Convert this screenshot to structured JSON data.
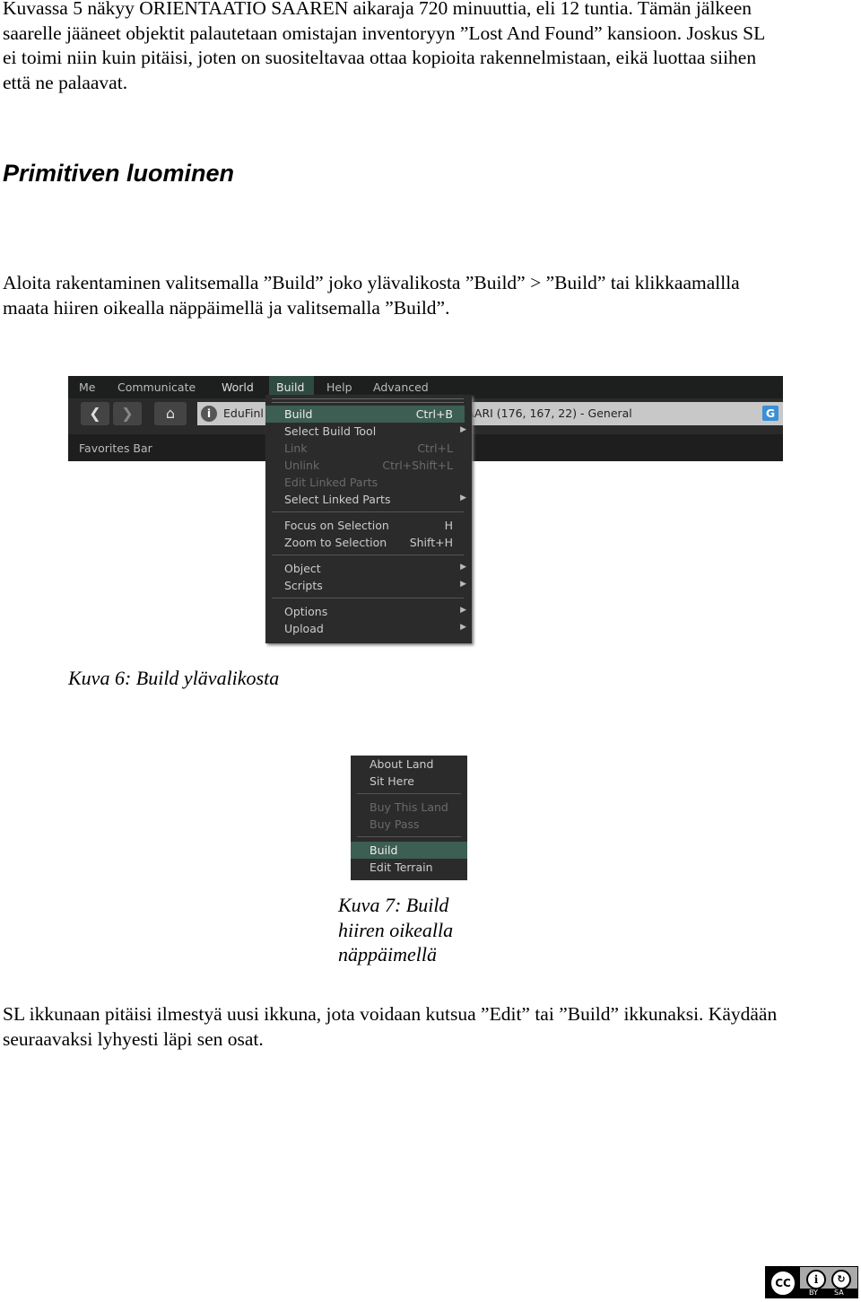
{
  "intro": {
    "lines": [
      "Kuvassa 5 näkyy ORIENTAATIO SAAREN aikaraja 720 minuuttia, eli 12 tuntia. Tämän jälkeen",
      "saarelle jääneet objektit palautetaan omistajan inventoryyn ”Lost And Found” kansioon. Joskus SL",
      "ei toimi niin kuin pitäisi, joten on suositeltavaa ottaa kopioita rakennelmistaan, eikä luottaa siihen",
      "että ne palaavat."
    ]
  },
  "heading": "Primitiven luominen",
  "para2": {
    "lines": [
      "Aloita rakentaminen valitsemalla ”Build” joko ylävalikosta ”Build” > ”Build”  tai klikkaamallla",
      "maata hiiren oikealla näppäimellä ja valitsemalla ”Build”."
    ]
  },
  "screenshot1": {
    "menubar": [
      "Me",
      "Communicate",
      "World",
      "Build",
      "Help",
      "Advanced"
    ],
    "location_left": "EduFinl",
    "location_right": "AARI (176, 167, 22) - General",
    "location_badge": "G",
    "favorites": "Favorites Bar",
    "menu": [
      {
        "label": "Build",
        "shortcut": "Ctrl+B",
        "state": "highlighted"
      },
      {
        "label": "Select Build Tool",
        "submenu": true
      },
      {
        "label": "Link",
        "shortcut": "Ctrl+L",
        "state": "disabled"
      },
      {
        "label": "Unlink",
        "shortcut": "Ctrl+Shift+L",
        "state": "disabled"
      },
      {
        "label": "Edit Linked Parts",
        "state": "disabled"
      },
      {
        "label": "Select Linked Parts",
        "submenu": true
      },
      {
        "label": "Focus on Selection",
        "shortcut": "H"
      },
      {
        "label": "Zoom to Selection",
        "shortcut": "Shift+H"
      },
      {
        "label": "Object",
        "submenu": true
      },
      {
        "label": "Scripts",
        "submenu": true
      },
      {
        "label": "Options",
        "submenu": true
      },
      {
        "label": "Upload",
        "submenu": true
      }
    ],
    "accent": "#3d5e52"
  },
  "caption6": "Kuva 6: Build ylävalikosta",
  "screenshot2": {
    "menu": [
      {
        "label": "About Land"
      },
      {
        "label": "Sit Here"
      },
      {
        "label": "Buy This Land",
        "state": "disabled"
      },
      {
        "label": "Buy Pass",
        "state": "disabled"
      },
      {
        "label": "Build",
        "state": "highlighted"
      },
      {
        "label": "Edit Terrain"
      }
    ]
  },
  "caption7": {
    "lines": [
      "Kuva 7: Build",
      "hiiren oikealla",
      "näppäimellä"
    ]
  },
  "para3": {
    "lines": [
      "SL ikkunaan pitäisi ilmestyä uusi ikkuna, jota voidaan kutsua ”Edit” tai ”Build” ikkunaksi. Käydään",
      "seuraavaksi lyhyesti läpi sen osat."
    ]
  },
  "license": {
    "labels": [
      "BY",
      "SA"
    ],
    "text": "CC"
  }
}
